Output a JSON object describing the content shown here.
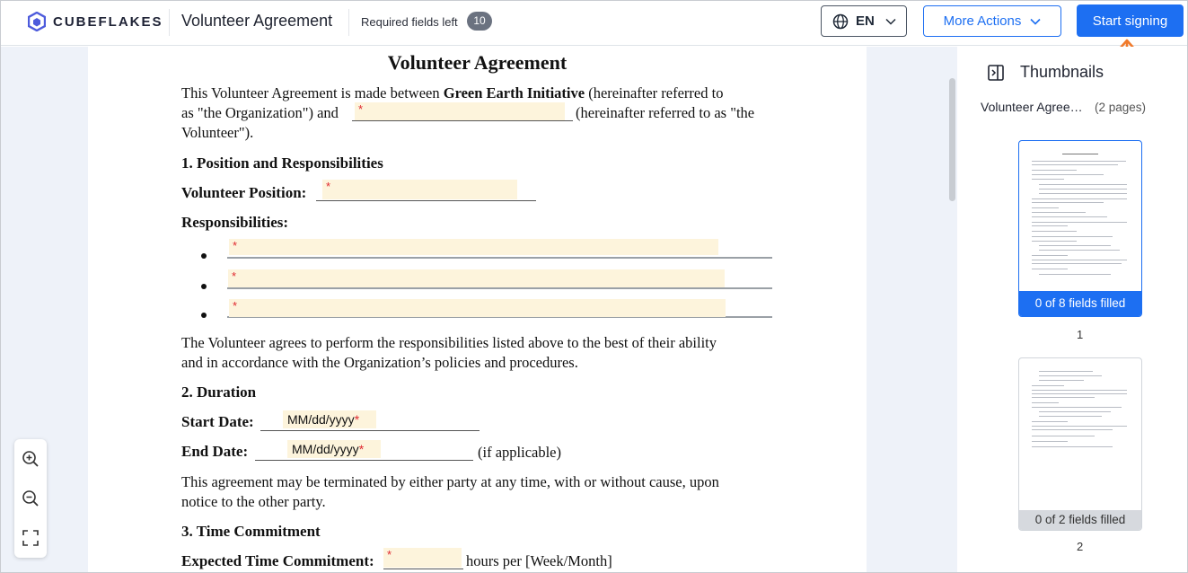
{
  "header": {
    "brand": "CUBEFLAKES",
    "doc_title": "Volunteer Agreement",
    "required_label": "Required fields left",
    "required_count": "10",
    "language": "EN",
    "more_actions": "More Actions",
    "start_signing": "Start signing"
  },
  "colors": {
    "accent": "#1d6ff2",
    "field_bg": "#fdf4dc",
    "required": "#e0282f",
    "annotation_arrow": "#f07a2b"
  },
  "document": {
    "title": "Volunteer Agreement",
    "intro_1_a": "This Volunteer Agreement is made between ",
    "intro_1_b": "Green Earth Initiative",
    "intro_1_c": " (hereinafter referred to",
    "intro_2_a": "as \"the Organization\") and",
    "intro_2_b": "(hereinafter referred to as \"the",
    "intro_3": "Volunteer\").",
    "sec1": "1. Position and Responsibilities",
    "position_label": "Volunteer Position:",
    "resp_label": "Responsibilities:",
    "agree_1": "The Volunteer agrees to perform the responsibilities listed above to the best of their ability",
    "agree_2": "and in accordance with the Organization’s policies and procedures.",
    "sec2": "2. Duration",
    "start_label": "Start Date:",
    "end_label": "End Date:",
    "if_applicable": "(if applicable)",
    "date_placeholder": "MM/dd/yyyy",
    "required_star": "*",
    "term_1": "This agreement may be terminated by either party at any time, with or without cause, upon",
    "term_2": "notice to the other party.",
    "sec3": "3. Time Commitment",
    "time_label": "Expected Time Commitment:",
    "time_suffix": "hours per [Week/Month]"
  },
  "zoom": {
    "icons": [
      "zoom-in-icon",
      "zoom-out-icon",
      "fit-screen-icon"
    ]
  },
  "sidebar": {
    "title": "Thumbnails",
    "doc_name": "Volunteer Agreement",
    "pages_count": "(2 pages)",
    "thumbs": [
      {
        "status": "0 of 8 fields filled",
        "page": "1"
      },
      {
        "status": "0 of 2 fields filled",
        "page": "2"
      }
    ]
  }
}
